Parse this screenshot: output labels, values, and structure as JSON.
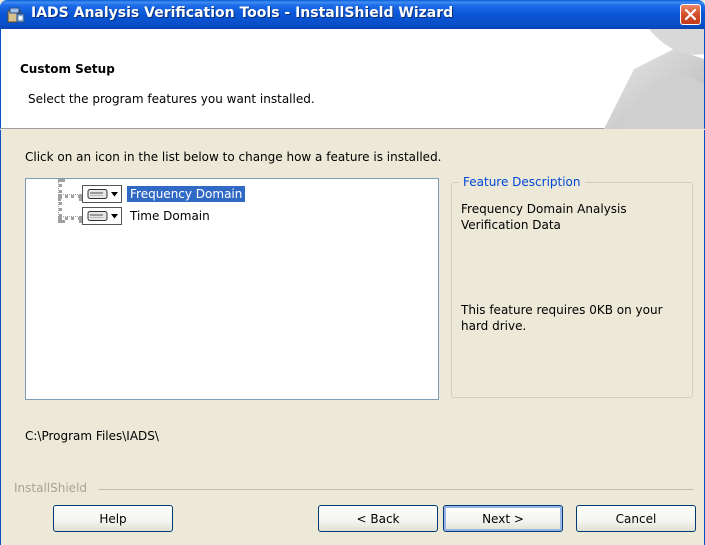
{
  "window": {
    "title": "IADS Analysis Verification Tools - InstallShield Wizard",
    "icon": "installer-icon",
    "close_icon": "close-icon"
  },
  "banner": {
    "title": "Custom Setup",
    "subtitle": "Select the program features you want installed."
  },
  "instruction": "Click on an icon in the list below to change how a feature is installed.",
  "features": [
    {
      "label": "Frequency Domain",
      "selected": true,
      "icon": "drive-icon"
    },
    {
      "label": "Time Domain",
      "selected": false,
      "icon": "drive-icon"
    }
  ],
  "description": {
    "legend": "Feature Description",
    "text": "Frequency Domain Analysis Verification Data",
    "size_note": "This feature requires 0KB on your hard drive."
  },
  "install_path": "C:\\Program Files\\IADS\\",
  "brand": "InstallShield",
  "buttons": {
    "help": "Help",
    "back": "< Back",
    "next": "Next >",
    "cancel": "Cancel"
  },
  "colors": {
    "titlebar": "#0a56d6",
    "selection": "#316ac5",
    "legend": "#0046d5",
    "dialog_bg": "#ece9d8"
  }
}
